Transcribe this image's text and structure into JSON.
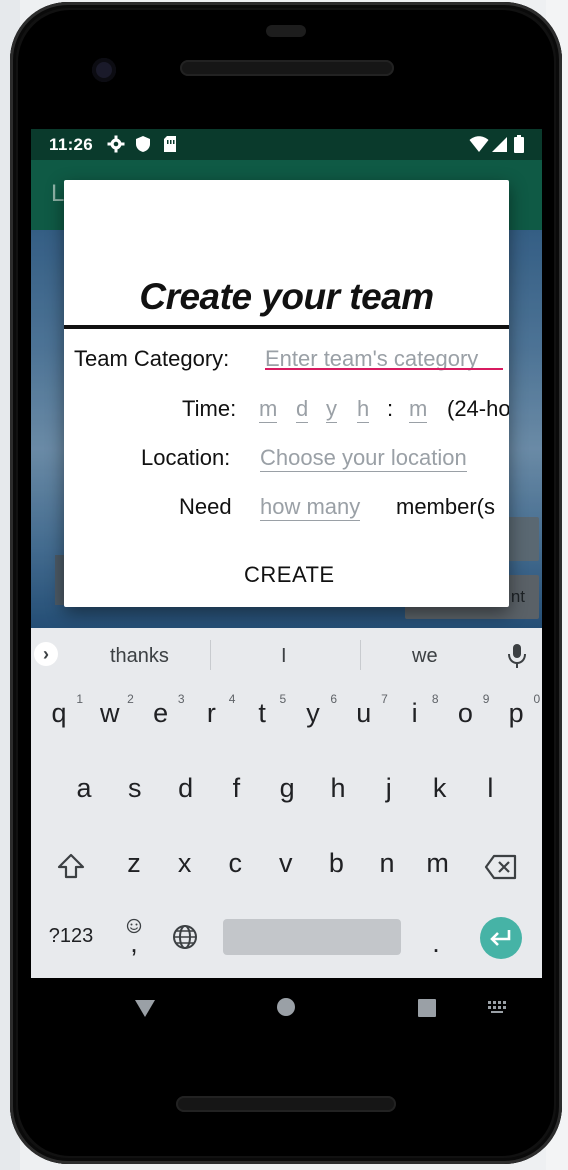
{
  "status_bar": {
    "time": "11:26"
  },
  "toolbar": {
    "title": "L"
  },
  "background": {
    "button_partial_label": "nt"
  },
  "dialog": {
    "title": "Create your team",
    "category_label": "Team Category:",
    "category_placeholder": "Enter team's category",
    "time_label": "Time:",
    "time_month_placeholder": "m",
    "time_day_placeholder": "d",
    "time_year_placeholder": "y",
    "time_hour_placeholder": "h",
    "time_colon": ":",
    "time_minute_placeholder": "m",
    "time_format_note": "(24-ho",
    "location_label": "Location:",
    "location_placeholder": "Choose your location",
    "need_label": "Need",
    "need_placeholder": "how many",
    "need_suffix": "member(s",
    "create_button": "CREATE"
  },
  "keyboard": {
    "suggestions": [
      "thanks",
      "I",
      "we"
    ],
    "row1": [
      {
        "key": "q",
        "num": "1"
      },
      {
        "key": "w",
        "num": "2"
      },
      {
        "key": "e",
        "num": "3"
      },
      {
        "key": "r",
        "num": "4"
      },
      {
        "key": "t",
        "num": "5"
      },
      {
        "key": "y",
        "num": "6"
      },
      {
        "key": "u",
        "num": "7"
      },
      {
        "key": "i",
        "num": "8"
      },
      {
        "key": "o",
        "num": "9"
      },
      {
        "key": "p",
        "num": "0"
      }
    ],
    "row2": [
      "a",
      "s",
      "d",
      "f",
      "g",
      "h",
      "j",
      "k",
      "l"
    ],
    "row3": [
      "z",
      "x",
      "c",
      "v",
      "b",
      "n",
      "m"
    ],
    "symbols_key": "?123",
    "comma_key": ",",
    "period_key": "."
  },
  "colors": {
    "status_bar": "#0a3a2c",
    "toolbar": "#0f5a45",
    "focus_underline": "#d81b60",
    "enter_key": "#46b3a6"
  }
}
